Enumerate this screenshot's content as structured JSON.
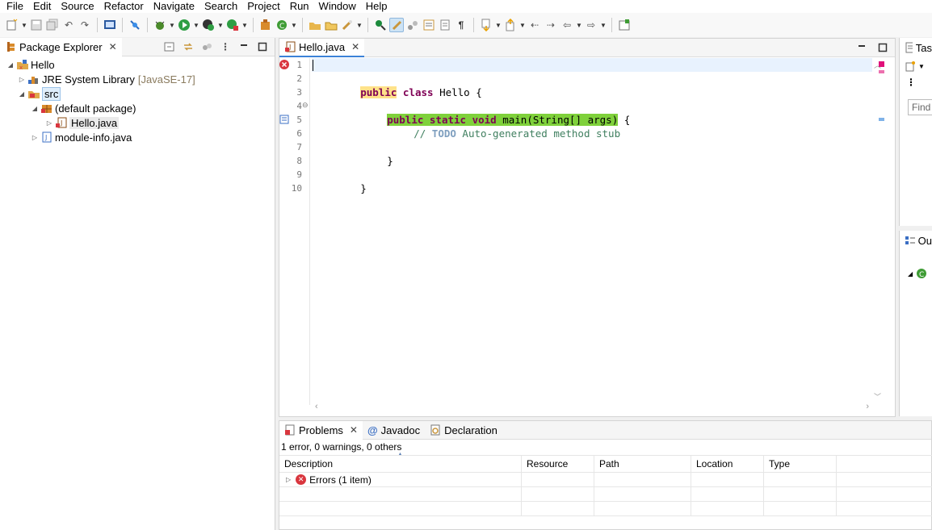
{
  "menu": [
    "File",
    "Edit",
    "Source",
    "Refactor",
    "Navigate",
    "Search",
    "Project",
    "Run",
    "Window",
    "Help"
  ],
  "package_explorer": {
    "title": "Package Explorer",
    "tree": [
      {
        "label": "Hello",
        "level": 0,
        "expanded": true,
        "icon": "project-icon"
      },
      {
        "label": "JRE System Library",
        "decoration": "[JavaSE-17]",
        "level": 1,
        "expanded": false,
        "icon": "library-icon"
      },
      {
        "label": "src",
        "level": 1,
        "expanded": true,
        "icon": "source-folder-icon",
        "selected": true
      },
      {
        "label": "(default package)",
        "level": 2,
        "expanded": true,
        "icon": "package-icon"
      },
      {
        "label": "Hello.java",
        "level": 3,
        "expanded": false,
        "icon": "java-file-icon"
      },
      {
        "label": "module-info.java",
        "level": 2,
        "expanded": false,
        "icon": "java-file-icon"
      }
    ]
  },
  "editor": {
    "tab": "Hello.java",
    "line_numbers": [
      "1",
      "2",
      "3",
      "4",
      "5",
      "6",
      "7",
      "8",
      "9",
      "10"
    ],
    "code": {
      "l2_kw1": "public",
      "l2_kw2": "class",
      "l2_rest": " Hello {",
      "l4_kw1": "public",
      "l4_kw2": "static",
      "l4_kw3": "void",
      "l4_rest": " main(String[] args)",
      "l4_tail": " {",
      "l5_comment": "// ",
      "l5_todo": "TODO",
      "l5_rest": " Auto-generated method stub",
      "l7": "}",
      "l9": "}"
    }
  },
  "right_panel": {
    "top_title": "Tas",
    "find_placeholder": "Find",
    "bottom_title": "Ou"
  },
  "problems": {
    "tabs": [
      "Problems",
      "Javadoc",
      "Declaration"
    ],
    "summary": "1 error, 0 warnings, 0 others",
    "columns": [
      "Description",
      "Resource",
      "Path",
      "Location",
      "Type"
    ],
    "rows": [
      {
        "description": "Errors (1 item)"
      }
    ]
  },
  "colors": {
    "keyword": "#7f0055",
    "comment": "#3f7f5f",
    "highlight_yellow": "#ffe28a",
    "highlight_green": "#7fd13b",
    "error": "#d9363e"
  }
}
